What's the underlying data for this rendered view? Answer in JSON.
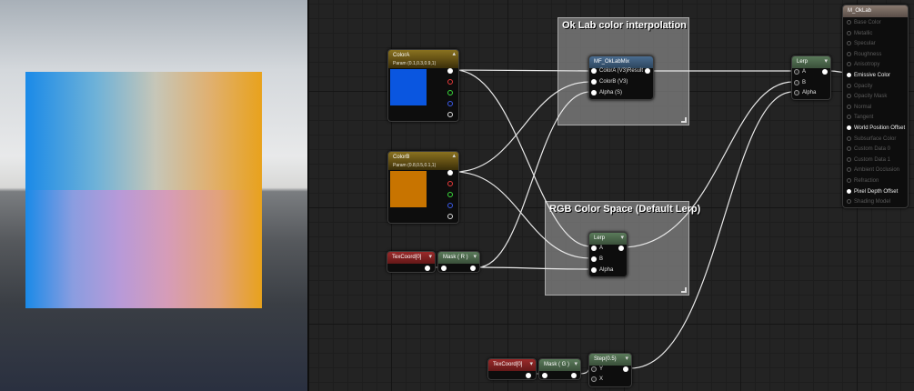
{
  "viewport": {},
  "comments": {
    "oklab": {
      "title": "Ok Lab color interpolation"
    },
    "rgb": {
      "title": "RGB Color Space (Default Lerp)"
    }
  },
  "nodes": {
    "colorA": {
      "title": "ColorA",
      "subtitle": "Param (0.1,0.3,0.9,1)",
      "swatch": "#0a56e0"
    },
    "colorB": {
      "title": "ColorB",
      "subtitle": "Param (0.8,0.5,0.1,1)",
      "swatch": "#c87400"
    },
    "texcoord1": {
      "title": "TexCoord[0]"
    },
    "mask1": {
      "title": "Mask ( R )"
    },
    "texcoord2": {
      "title": "TexCoord[0]"
    },
    "mask2": {
      "title": "Mask ( G )"
    },
    "step": {
      "title": "Step(0.5)",
      "inputs": [
        "Y",
        "X"
      ]
    },
    "mf_oklabmix": {
      "title": "MF_OkLabMix",
      "inputs": [
        "ColorA (V3)",
        "ColorB (V3)",
        "Alpha (S)"
      ],
      "output": "Result"
    },
    "lerp_rgb": {
      "title": "Lerp",
      "inputs": [
        "A",
        "B",
        "Alpha"
      ]
    },
    "lerp_final": {
      "title": "Lerp",
      "inputs": [
        "A",
        "B",
        "Alpha"
      ]
    },
    "material": {
      "title": "M_OkLab",
      "inputs": [
        {
          "label": "Base Color",
          "active": false
        },
        {
          "label": "Metallic",
          "active": false
        },
        {
          "label": "Specular",
          "active": false
        },
        {
          "label": "Roughness",
          "active": false
        },
        {
          "label": "Anisotropy",
          "active": false
        },
        {
          "label": "Emissive Color",
          "active": true
        },
        {
          "label": "Opacity",
          "active": false
        },
        {
          "label": "Opacity Mask",
          "active": false
        },
        {
          "label": "Normal",
          "active": false
        },
        {
          "label": "Tangent",
          "active": false
        },
        {
          "label": "World Position Offset",
          "active": true
        },
        {
          "label": "Subsurface Color",
          "active": false
        },
        {
          "label": "Custom Data 0",
          "active": false
        },
        {
          "label": "Custom Data 1",
          "active": false
        },
        {
          "label": "Ambient Occlusion",
          "active": false
        },
        {
          "label": "Refraction",
          "active": false
        },
        {
          "label": "Pixel Depth Offset",
          "active": true
        },
        {
          "label": "Shading Model",
          "active": false
        }
      ]
    }
  },
  "colors": {
    "wire": "#e8e8e8",
    "background": "#232323"
  }
}
